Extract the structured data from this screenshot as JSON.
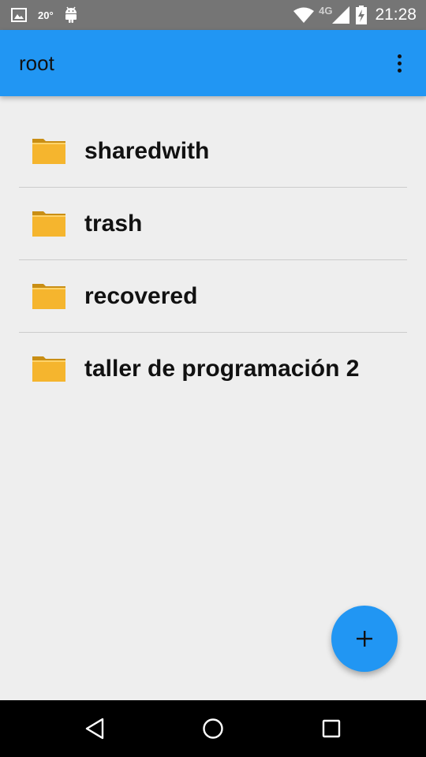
{
  "status_bar": {
    "temperature": "20°",
    "network": "4G",
    "time": "21:28",
    "icons": [
      "image-icon",
      "android-icon",
      "wifi-icon",
      "signal-icon",
      "battery-charging-icon"
    ]
  },
  "app_bar": {
    "title": "root",
    "menu_icon": "overflow-menu-icon"
  },
  "folders": [
    {
      "name": "sharedwith",
      "icon": "folder-icon"
    },
    {
      "name": "trash",
      "icon": "folder-icon"
    },
    {
      "name": "recovered",
      "icon": "folder-icon"
    },
    {
      "name": "taller de programación 2",
      "icon": "folder-icon"
    }
  ],
  "fab": {
    "icon": "add-icon"
  },
  "nav_bar": {
    "icons": [
      "back-icon",
      "home-icon",
      "recents-icon"
    ]
  },
  "colors": {
    "primary": "#2196f3",
    "status_bar": "#757575",
    "background": "#eeeeee",
    "folder": "#f5b52e"
  }
}
